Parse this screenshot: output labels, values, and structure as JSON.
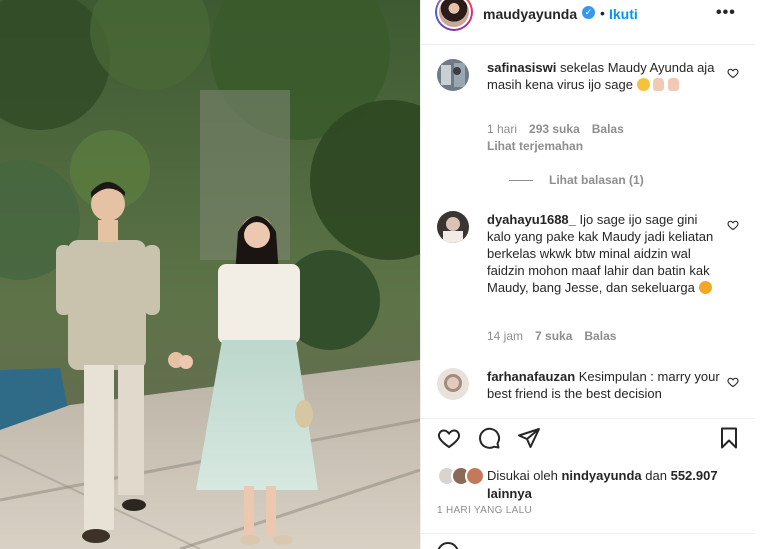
{
  "post": {
    "username": "maudyayunda",
    "verified_icon": "verified-badge-icon",
    "separator": "•",
    "follow_label": "Ikuti",
    "more_label": "•••"
  },
  "comments": [
    {
      "username": "safinasiswi",
      "text": "sekelas Maudy Ayunda aja masih kena virus ijo sage",
      "emojis": [
        "crying-face-emoji",
        "thumbs-up-emoji",
        "thumbs-up-emoji"
      ],
      "time": "1 hari",
      "likes": "293 suka",
      "reply_label": "Balas",
      "translate_label": "Lihat terjemahan",
      "view_replies_label": "Lihat balasan (1)"
    },
    {
      "username": "dyahayu1688_",
      "text": "Ijo sage ijo sage gini kalo yang pake kak Maudy jadi keliatan berkelas wkwk btw minal aidzin wal faidzin mohon maaf lahir dan batin kak Maudy, bang Jesse, dan sekeluarga",
      "emojis": [
        "smiling-face-emoji"
      ],
      "time": "14 jam",
      "likes": "7 suka",
      "reply_label": "Balas"
    },
    {
      "username": "farhanafauzan",
      "text": "Kesimpulan : marry your best friend is the best decision"
    }
  ],
  "likes_summary": {
    "prefix": "Disukai oleh",
    "liker": "nindyayunda",
    "middle": "dan",
    "count": "552.907",
    "suffix": "lainnya"
  },
  "posted_ago": "1 HARI YANG LALU",
  "colors": {
    "accent": "#0095f6",
    "verified": "#3897f0",
    "muted": "#8e8e8e",
    "text": "#262626"
  }
}
